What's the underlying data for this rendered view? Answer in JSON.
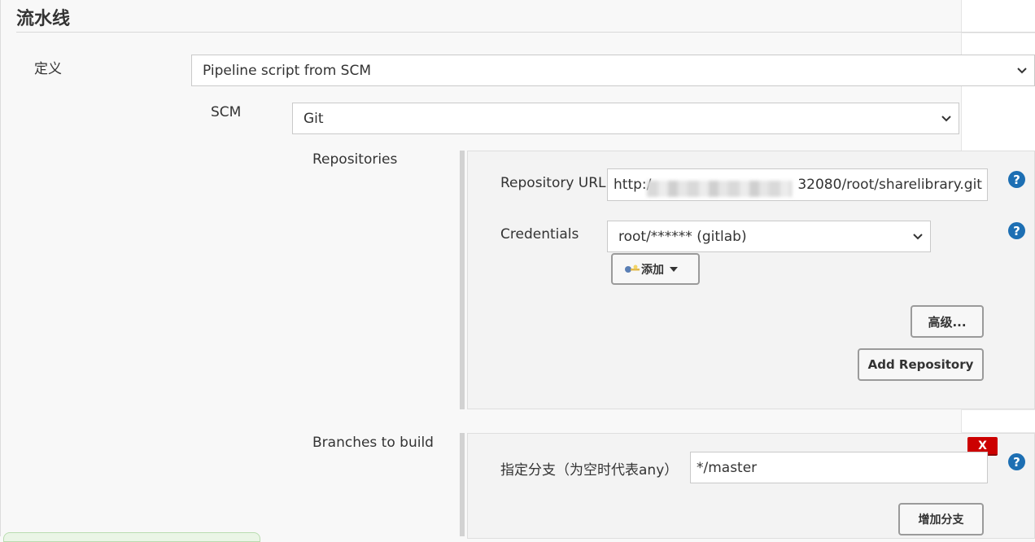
{
  "section": {
    "title": "流水线"
  },
  "definition": {
    "label": "定义",
    "value": "Pipeline script from SCM"
  },
  "scm": {
    "label": "SCM",
    "value": "Git"
  },
  "repositories": {
    "label": "Repositories",
    "url_label": "Repository URL",
    "url_prefix": "http:/",
    "url_suffix": "32080/root/sharelibrary.git",
    "credentials_label": "Credentials",
    "credentials_value": "root/****** (gitlab)",
    "add_label": "添加",
    "advanced_label": "高级...",
    "add_repository_label": "Add Repository"
  },
  "branches": {
    "label": "Branches to build",
    "spec_label": "指定分支（为空时代表any）",
    "spec_value": "*/master",
    "delete_label": "X",
    "add_branch_label": "增加分支"
  },
  "help": {
    "symbol": "?"
  },
  "colors": {
    "help_blue": "#1d6fb3",
    "delete_red": "#cc0000"
  },
  "icons": [
    "chevron-down-icon",
    "help-icon",
    "key-icon",
    "caret-down-icon"
  ]
}
